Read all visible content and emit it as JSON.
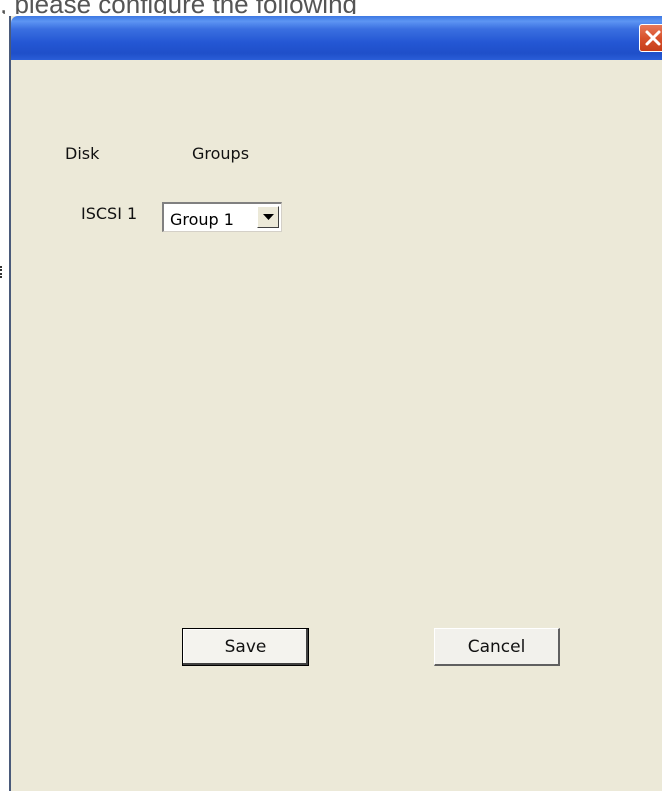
{
  "top_caption": ", please configure the following",
  "dialog": {
    "close_icon": "close-icon"
  },
  "form": {
    "disk_header": "Disk",
    "groups_header": "Groups",
    "rows": [
      {
        "disk": "ISCSI 1",
        "group": "Group 1"
      }
    ]
  },
  "buttons": {
    "save": "Save",
    "cancel": "Cancel"
  },
  "colors": {
    "titlebar": "#2457d4",
    "close_button": "#d8512c",
    "dialog_background": "#ece9d8"
  }
}
